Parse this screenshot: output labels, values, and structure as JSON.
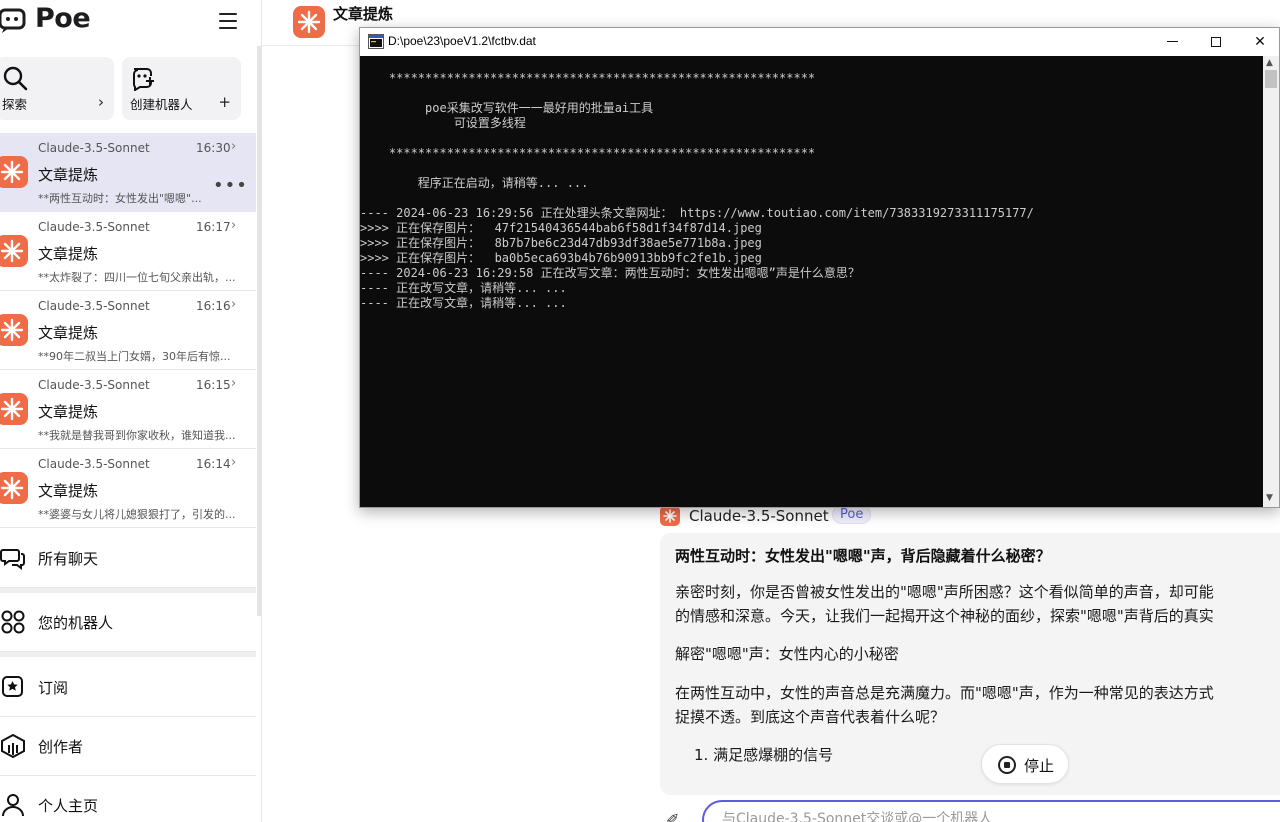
{
  "app": {
    "logo_text": "Poe",
    "brand_color": "#5d5cde",
    "bot_icon_color": "#ef6c48"
  },
  "sidebar": {
    "quick": [
      {
        "label": "探索",
        "icon": "search-icon",
        "arrow": "›"
      },
      {
        "label": "创建机器人",
        "icon": "create-bot-icon",
        "arrow": "+"
      }
    ],
    "chats": [
      {
        "bot": "Claude-3.5-Sonnet",
        "time": "16:30",
        "title": "文章提炼",
        "preview": "**两性互动时：女性发出\"嗯嗯\"...",
        "active": true,
        "more": "•••"
      },
      {
        "bot": "Claude-3.5-Sonnet",
        "time": "16:17",
        "title": "文章提炼",
        "preview": "**太炸裂了：四川一位七旬父亲出轨，..."
      },
      {
        "bot": "Claude-3.5-Sonnet",
        "time": "16:16",
        "title": "文章提炼",
        "preview": "**90年二叔当上门女婿，30年后有惊..."
      },
      {
        "bot": "Claude-3.5-Sonnet",
        "time": "16:15",
        "title": "文章提炼",
        "preview": "**我就是替我哥到你家收秋，谁知道我..."
      },
      {
        "bot": "Claude-3.5-Sonnet",
        "time": "16:14",
        "title": "文章提炼",
        "preview": "**婆婆与女儿将儿媳狠狠打了，引发的..."
      }
    ],
    "nav": [
      {
        "label": "所有聊天",
        "icon": "chat-bubbles-icon"
      },
      {
        "label": "您的机器人",
        "icon": "bots-grid-icon"
      },
      {
        "label": "订阅",
        "icon": "subscription-icon"
      },
      {
        "label": "创作者",
        "icon": "creator-icon"
      },
      {
        "label": "个人主页",
        "icon": "profile-icon"
      }
    ]
  },
  "header": {
    "title": "文章提炼"
  },
  "message": {
    "bot_name": "Claude-3.5-Sonnet",
    "badge": "Poe",
    "heading": "两性互动时：女性发出\"嗯嗯\"声，背后隐藏着什么秘密？",
    "p1_line1": "亲密时刻，你是否曾被女性发出的\"嗯嗯\"声所困惑？这个看似简单的声音，却可能",
    "p1_line2": "的情感和深意。今天，让我们一起揭开这个神秘的面纱，探索\"嗯嗯\"声背后的真实",
    "p2": "解密\"嗯嗯\"声：女性内心的小秘密",
    "p3_line1": "在两性互动中，女性的声音总是充满魔力。而\"嗯嗯\"声，作为一种常见的表达方式",
    "p3_line2": "捉摸不透。到底这个声音代表着什么呢？",
    "list_item": "1. 满足感爆棚的信号",
    "stop_label": "停止"
  },
  "composer": {
    "placeholder": "与Claude-3.5-Sonnet交谈或@一个机器人"
  },
  "console": {
    "title": "D:\\poe\\23\\poeV1.2\\fctbv.dat",
    "lines": [
      "",
      "    ***********************************************************",
      "",
      "         poe采集改写软件一一最好用的批量ai工具",
      "             可设置多线程",
      "",
      "    ***********************************************************",
      "",
      "        程序正在启动，请稍等... ...",
      "",
      "---- 2024-06-23 16:29:56 正在处理头条文章网址： https://www.toutiao.com/item/7383319273311175177/",
      ">>>> 正在保存图片：  47f21540436544bab6f58d1f34f87d14.jpeg",
      ">>>> 正在保存图片：  8b7b7be6c23d47db93df38ae5e771b8a.jpeg",
      ">>>> 正在保存图片：  ba0b5eca693b4b76b90913bb9fc2fe1b.jpeg",
      "---- 2024-06-23 16:29:58 正在改写文章：两性互动时：女性发出嗯嗯”声是什么意思？",
      "---- 正在改写文章，请稍等... ...",
      "---- 正在改写文章，请稍等... ..."
    ]
  }
}
